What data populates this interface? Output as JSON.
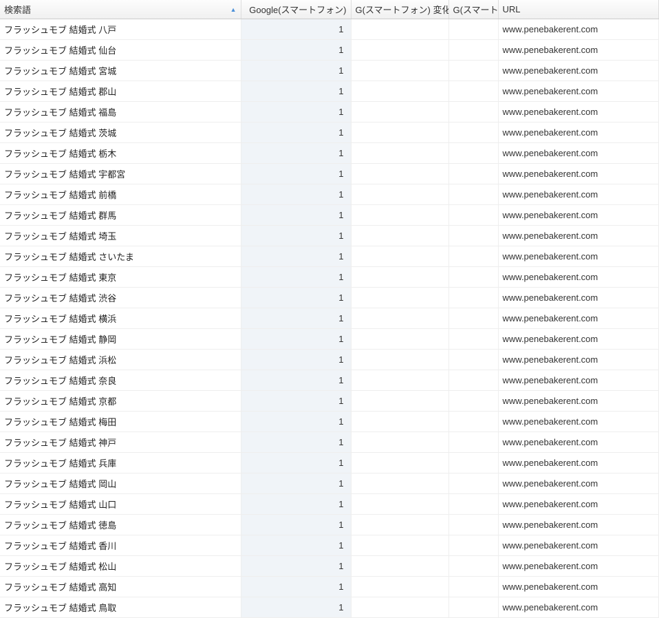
{
  "table": {
    "headers": {
      "keyword": "検索語",
      "google": "Google(スマートフォン)",
      "change": "G(スマートフォン) 変化",
      "trunc": "G(スマートフ..",
      "url": "URL"
    },
    "sort_indicator": "▲",
    "rows": [
      {
        "keyword": "フラッシュモブ 結婚式 八戸",
        "google": "1",
        "change": "",
        "trunc": "",
        "url": "www.penebakerent.com"
      },
      {
        "keyword": "フラッシュモブ 結婚式 仙台",
        "google": "1",
        "change": "",
        "trunc": "",
        "url": "www.penebakerent.com"
      },
      {
        "keyword": "フラッシュモブ 結婚式 宮城",
        "google": "1",
        "change": "",
        "trunc": "",
        "url": "www.penebakerent.com"
      },
      {
        "keyword": "フラッシュモブ 結婚式 郡山",
        "google": "1",
        "change": "",
        "trunc": "",
        "url": "www.penebakerent.com"
      },
      {
        "keyword": "フラッシュモブ 結婚式 福島",
        "google": "1",
        "change": "",
        "trunc": "",
        "url": "www.penebakerent.com"
      },
      {
        "keyword": "フラッシュモブ 結婚式 茨城",
        "google": "1",
        "change": "",
        "trunc": "",
        "url": "www.penebakerent.com"
      },
      {
        "keyword": "フラッシュモブ 結婚式 栃木",
        "google": "1",
        "change": "",
        "trunc": "",
        "url": "www.penebakerent.com"
      },
      {
        "keyword": "フラッシュモブ 結婚式 宇都宮",
        "google": "1",
        "change": "",
        "trunc": "",
        "url": "www.penebakerent.com"
      },
      {
        "keyword": "フラッシュモブ 結婚式 前橋",
        "google": "1",
        "change": "",
        "trunc": "",
        "url": "www.penebakerent.com"
      },
      {
        "keyword": "フラッシュモブ 結婚式 群馬",
        "google": "1",
        "change": "",
        "trunc": "",
        "url": "www.penebakerent.com"
      },
      {
        "keyword": "フラッシュモブ 結婚式 埼玉",
        "google": "1",
        "change": "",
        "trunc": "",
        "url": "www.penebakerent.com"
      },
      {
        "keyword": "フラッシュモブ 結婚式 さいたま",
        "google": "1",
        "change": "",
        "trunc": "",
        "url": "www.penebakerent.com"
      },
      {
        "keyword": "フラッシュモブ 結婚式 東京",
        "google": "1",
        "change": "",
        "trunc": "",
        "url": "www.penebakerent.com"
      },
      {
        "keyword": "フラッシュモブ 結婚式 渋谷",
        "google": "1",
        "change": "",
        "trunc": "",
        "url": "www.penebakerent.com"
      },
      {
        "keyword": "フラッシュモブ 結婚式 横浜",
        "google": "1",
        "change": "",
        "trunc": "",
        "url": "www.penebakerent.com"
      },
      {
        "keyword": "フラッシュモブ 結婚式 静岡",
        "google": "1",
        "change": "",
        "trunc": "",
        "url": "www.penebakerent.com"
      },
      {
        "keyword": "フラッシュモブ 結婚式 浜松",
        "google": "1",
        "change": "",
        "trunc": "",
        "url": "www.penebakerent.com"
      },
      {
        "keyword": "フラッシュモブ 結婚式 奈良",
        "google": "1",
        "change": "",
        "trunc": "",
        "url": "www.penebakerent.com"
      },
      {
        "keyword": "フラッシュモブ 結婚式 京都",
        "google": "1",
        "change": "",
        "trunc": "",
        "url": "www.penebakerent.com"
      },
      {
        "keyword": "フラッシュモブ 結婚式 梅田",
        "google": "1",
        "change": "",
        "trunc": "",
        "url": "www.penebakerent.com"
      },
      {
        "keyword": "フラッシュモブ 結婚式 神戸",
        "google": "1",
        "change": "",
        "trunc": "",
        "url": "www.penebakerent.com"
      },
      {
        "keyword": "フラッシュモブ 結婚式 兵庫",
        "google": "1",
        "change": "",
        "trunc": "",
        "url": "www.penebakerent.com"
      },
      {
        "keyword": "フラッシュモブ 結婚式 岡山",
        "google": "1",
        "change": "",
        "trunc": "",
        "url": "www.penebakerent.com"
      },
      {
        "keyword": "フラッシュモブ 結婚式 山口",
        "google": "1",
        "change": "",
        "trunc": "",
        "url": "www.penebakerent.com"
      },
      {
        "keyword": "フラッシュモブ 結婚式 徳島",
        "google": "1",
        "change": "",
        "trunc": "",
        "url": "www.penebakerent.com"
      },
      {
        "keyword": "フラッシュモブ 結婚式 香川",
        "google": "1",
        "change": "",
        "trunc": "",
        "url": "www.penebakerent.com"
      },
      {
        "keyword": "フラッシュモブ 結婚式 松山",
        "google": "1",
        "change": "",
        "trunc": "",
        "url": "www.penebakerent.com"
      },
      {
        "keyword": "フラッシュモブ 結婚式 高知",
        "google": "1",
        "change": "",
        "trunc": "",
        "url": "www.penebakerent.com"
      },
      {
        "keyword": "フラッシュモブ 結婚式 鳥取",
        "google": "1",
        "change": "",
        "trunc": "",
        "url": "www.penebakerent.com"
      }
    ]
  }
}
